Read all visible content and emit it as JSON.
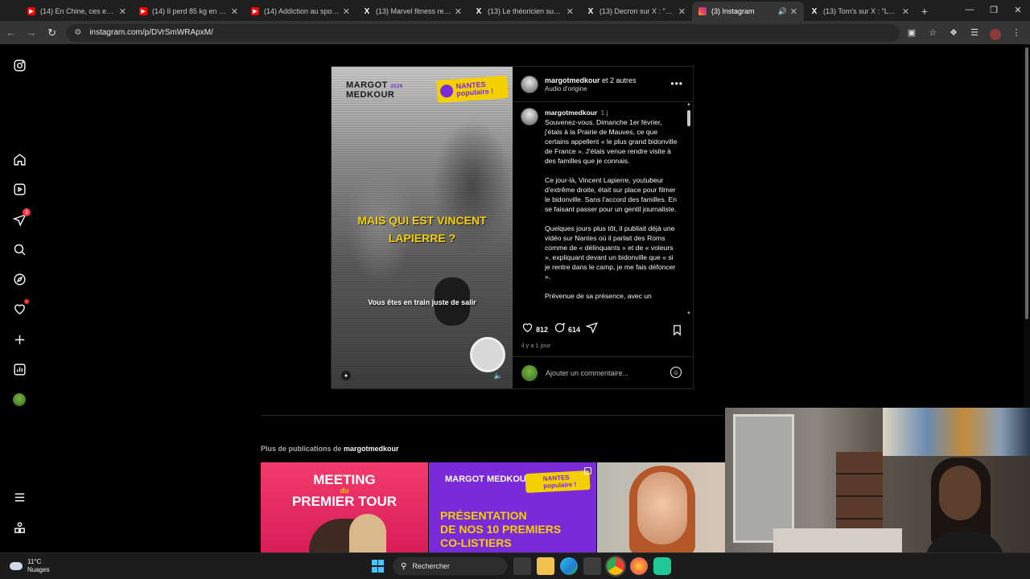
{
  "browser": {
    "tabs": [
      {
        "favicon": "youtube-icon",
        "title": "(14) En Chine, ces enfants"
      },
      {
        "favicon": "youtube-icon",
        "title": "(14) Il perd 85 kg en faisa"
      },
      {
        "favicon": "youtube-icon",
        "title": "(14) Addiction au sport : d"
      },
      {
        "favicon": "x-icon",
        "title": "(13) Marvel fitness re (@M"
      },
      {
        "favicon": "x-icon",
        "title": "(13) Le théoricien sur X : \""
      },
      {
        "favicon": "x-icon",
        "title": "(13) Decron sur X : \"@_to"
      },
      {
        "favicon": "instagram-icon",
        "title": "(3) Instagram",
        "active": true
      },
      {
        "favicon": "x-icon",
        "title": "(13) Tom's sur X : \"Les pa"
      }
    ],
    "url": "instagram.com/p/DVrSmWRApxM/"
  },
  "sidebar": {
    "icons": [
      "instagram-logo-icon",
      "home-icon",
      "reels-icon",
      "direct-icon",
      "search-icon",
      "explore-icon",
      "notifications-icon",
      "create-icon",
      "dashboard-icon",
      "profile-avatar",
      "menu-icon",
      "also-from-meta-icon"
    ],
    "direct_badge": "3"
  },
  "post": {
    "media": {
      "logo_line1": "MARGOT",
      "logo_year": "2026",
      "logo_line2": "MEDKOUR",
      "badge_line1": "NANTES",
      "badge_line2": "populaire !",
      "headline_line1": "MAIS QUI EST VINCENT",
      "headline_line2": "LAPIERRE ?",
      "subtitle": "Vous êtes en train juste de salir"
    },
    "header": {
      "username": "margotmedkour",
      "coauthors": "et 2 autres",
      "audio": "Audio d'origine"
    },
    "caption": {
      "username": "margotmedkour",
      "time": "1 j",
      "paragraphs": [
        "Souvenez-vous. Dimanche 1er février, j'étais à la Prairie de Mauves, ce que certains appellent « le plus grand bidonville de France ». J'étais venue rendre visite à des familles que je connais.",
        "Ce jour-là, Vincent Lapierre, youtubeur d'extrême droite, était sur place pour filmer le bidonville. Sans l'accord des familles. En se faisant passer pour un gentil journaliste.",
        "Quelques jours plus tôt, il publiait déjà une vidéo sur Nantes où il parlait des Roms comme de « délinquants » et de « voleurs », expliquant devant un bidonville que « si je rentre dans le camp, je me fais défoncer ».",
        "Prévenue de sa présence, avec un"
      ]
    },
    "likes": "812",
    "comments_count": "614",
    "posted": "il y a 1 jour",
    "comment_placeholder": "Ajouter un commentaire..."
  },
  "more_posts": {
    "label": "Plus de publications de",
    "username": "margotmedkour",
    "tiles": [
      {
        "line1": "MEETING",
        "line_small": "du",
        "line2": "PREMIER TOUR"
      },
      {
        "logo": "MARGOT MEDKOUR",
        "badge": "NANTES populaire !",
        "line1": "PRÉSENTATION",
        "line2": "DE NOS 10 PREMIERS",
        "line3": "CO-LISTIERS"
      },
      {}
    ]
  },
  "taskbar": {
    "temperature": "11°C",
    "weather": "Nuages",
    "search_placeholder": "Rechercher"
  },
  "colors": {
    "ig_bg": "#000000",
    "brand_yellow": "#f4d000",
    "brand_purple": "#7a2ad8",
    "notif_red": "#ff3040"
  }
}
